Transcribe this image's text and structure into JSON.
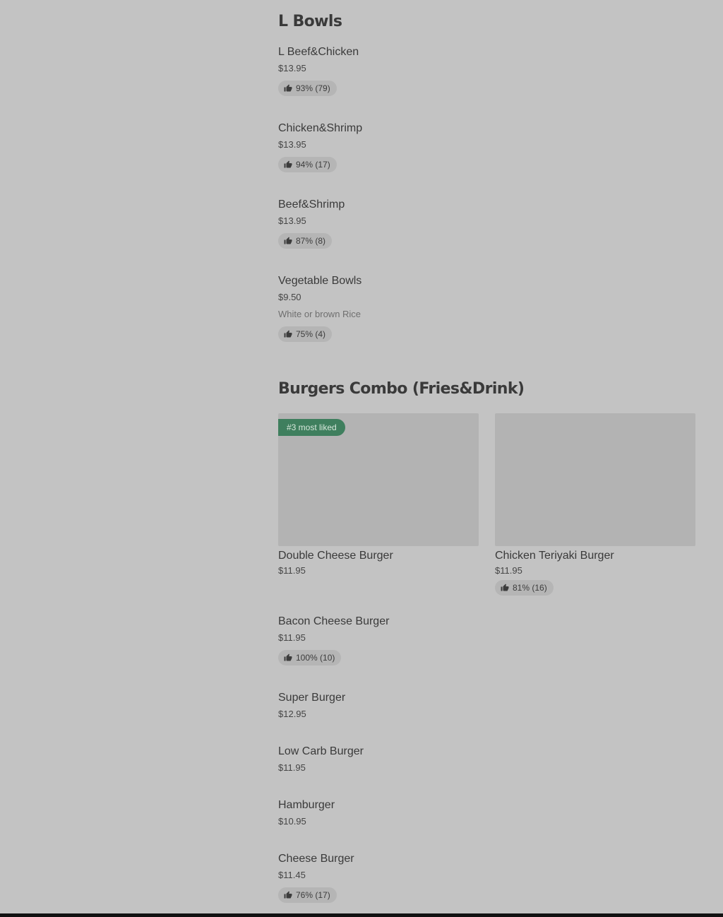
{
  "sections": {
    "bowls": {
      "title": "L Bowls",
      "items": [
        {
          "name": "L Beef&Chicken",
          "price": "$13.95",
          "rating": "93% (79)"
        },
        {
          "name": "Chicken&Shrimp",
          "price": "$13.95",
          "rating": "94% (17)"
        },
        {
          "name": "Beef&Shrimp",
          "price": "$13.95",
          "rating": "87% (8)"
        },
        {
          "name": "Vegetable Bowls",
          "price": "$9.50",
          "description": "White or brown Rice",
          "rating": "75% (4)"
        }
      ]
    },
    "burgers": {
      "title": "Burgers Combo (Fries&Drink)",
      "featured": [
        {
          "badge": "#3 most liked",
          "name": "Double Cheese Burger",
          "price": "$11.95"
        },
        {
          "name": "Chicken Teriyaki Burger",
          "price": "$11.95",
          "rating": "81% (16)"
        }
      ],
      "items": [
        {
          "name": "Bacon Cheese Burger",
          "price": "$11.95",
          "rating": "100% (10)"
        },
        {
          "name": "Super Burger",
          "price": "$12.95"
        },
        {
          "name": "Low Carb Burger",
          "price": "$11.95"
        },
        {
          "name": "Hamburger",
          "price": "$10.95"
        },
        {
          "name": "Cheese Burger",
          "price": "$11.45",
          "rating": "76% (17)"
        }
      ]
    }
  },
  "icons": {
    "rating": "thumbs-up-icon"
  },
  "colors": {
    "badge": "#3f7f5e",
    "background": "#c3c3c3"
  }
}
